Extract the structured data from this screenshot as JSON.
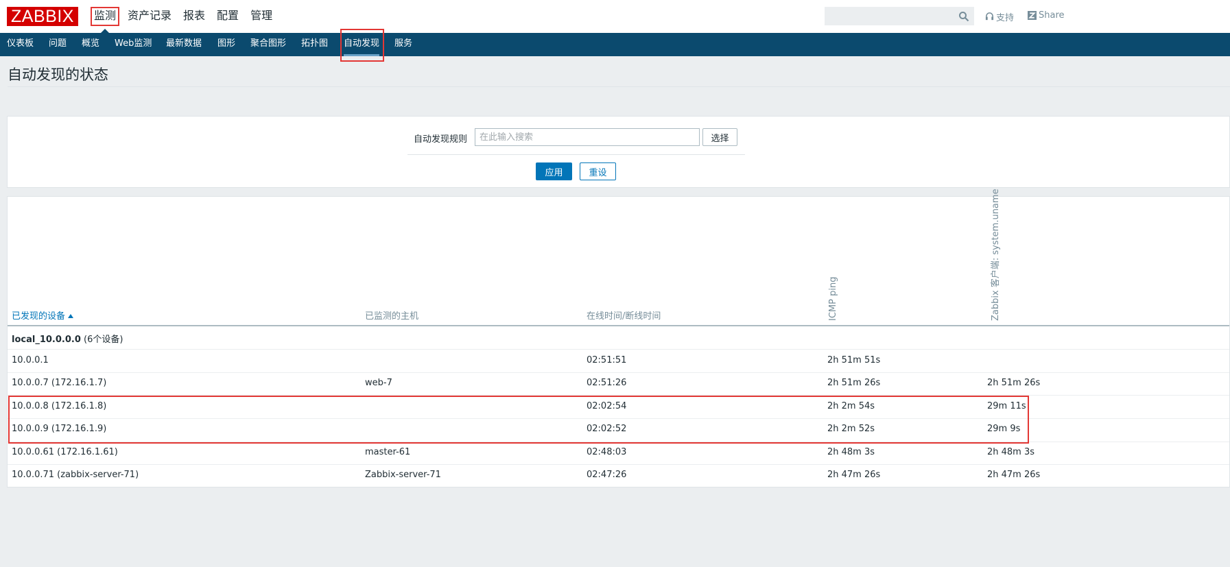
{
  "header": {
    "logo": "ZABBIX",
    "menu": [
      "监测",
      "资产记录",
      "报表",
      "配置",
      "管理"
    ],
    "search_placeholder": "",
    "support": "支持",
    "share": "Share"
  },
  "subnav": {
    "items": [
      "仪表板",
      "问题",
      "概览",
      "Web监测",
      "最新数据",
      "图形",
      "聚合图形",
      "拓扑图",
      "自动发现",
      "服务"
    ],
    "active": "自动发现"
  },
  "page": {
    "title": "自动发现的状态"
  },
  "filter": {
    "label": "自动发现规则",
    "placeholder": "在此输入搜索",
    "select_button": "选择",
    "apply": "应用",
    "reset": "重设"
  },
  "table": {
    "headers": {
      "device": "已发现的设备",
      "host": "已监测的主机",
      "uptime": "在线时间/断线时间",
      "icmp": "ICMP ping",
      "agent": "Zabbix 客户端: system.uname"
    },
    "group": {
      "name": "local_10.0.0.0",
      "count": "(6个设备)"
    },
    "rows": [
      {
        "device": "10.0.0.1",
        "host": "",
        "uptime": "02:51:51",
        "icmp": "2h 51m 51s",
        "agent": ""
      },
      {
        "device": "10.0.0.7 (172.16.1.7)",
        "host": "web-7",
        "uptime": "02:51:26",
        "icmp": "2h 51m 26s",
        "agent": "2h 51m 26s"
      },
      {
        "device": "10.0.0.8 (172.16.1.8)",
        "host": "",
        "uptime": "02:02:54",
        "icmp": "2h 2m 54s",
        "agent": "29m 11s"
      },
      {
        "device": "10.0.0.9 (172.16.1.9)",
        "host": "",
        "uptime": "02:02:52",
        "icmp": "2h 2m 52s",
        "agent": "29m 9s"
      },
      {
        "device": "10.0.0.61 (172.16.1.61)",
        "host": "master-61",
        "uptime": "02:48:03",
        "icmp": "2h 48m 3s",
        "agent": "2h 48m 3s"
      },
      {
        "device": "10.0.0.71 (zabbix-server-71)",
        "host": "Zabbix-server-71",
        "uptime": "02:47:26",
        "icmp": "2h 47m 26s",
        "agent": "2h 47m 26s"
      }
    ]
  },
  "colors": {
    "brand": "#d40000",
    "nav": "#0b4a6e",
    "link": "#0275b8",
    "highlight": "#e33734"
  }
}
